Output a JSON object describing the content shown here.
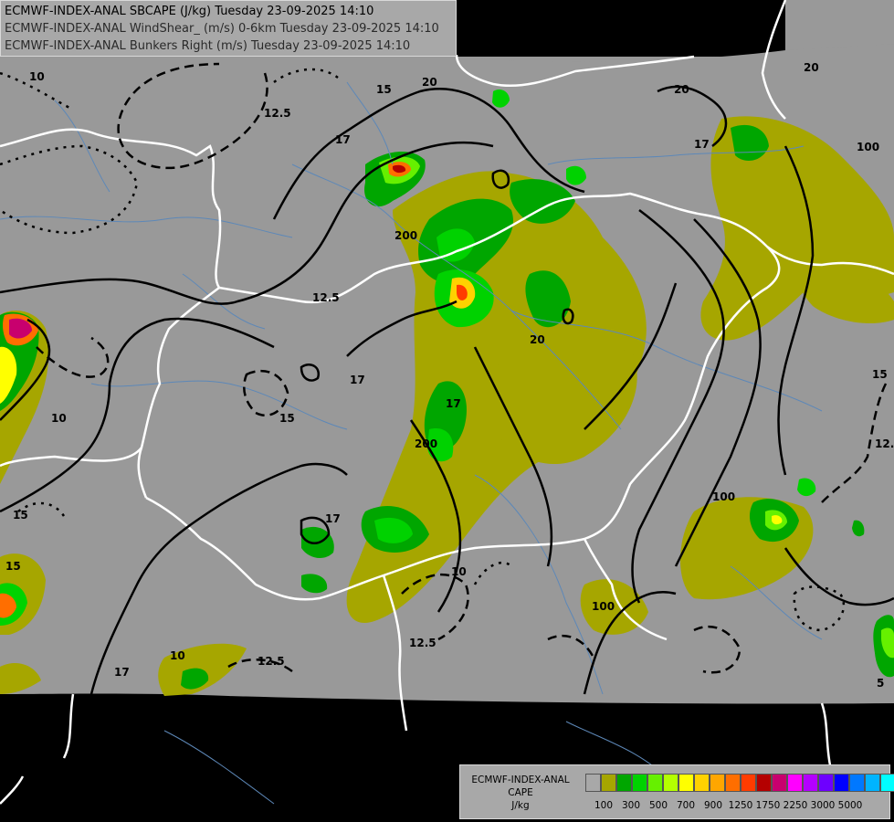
{
  "titles": [
    "ECMWF-INDEX-ANAL SBCAPE (J/kg) Tuesday 23-09-2025 14:10",
    "ECMWF-INDEX-ANAL WindShear_ (m/s) 0-6km Tuesday 23-09-2025 14:10",
    "ECMWF-INDEX-ANAL Bunkers Right (m/s) Tuesday 23-09-2025 14:10"
  ],
  "legend": {
    "title_line1": "ECMWF-INDEX-ANAL",
    "title_line2": "CAPE",
    "unit": "J/kg",
    "swatch_colors": [
      "#a8a8a8",
      "#a6a600",
      "#00a600",
      "#00d200",
      "#66f000",
      "#b4ff00",
      "#ffff00",
      "#ffd200",
      "#ffa600",
      "#ff6e00",
      "#ff3c00",
      "#b40000",
      "#c8006e",
      "#ff00ff",
      "#b400ff",
      "#6e00ff",
      "#0000ff",
      "#0078ff",
      "#00b4ff",
      "#00ffff",
      "#96ffff",
      "#ffffff"
    ],
    "tick_labels": [
      "100",
      "300",
      "500",
      "700",
      "900",
      "1250",
      "1750",
      "2250",
      "3000",
      "5000"
    ]
  },
  "contour_labels": [
    "10",
    "12.5",
    "15",
    "17",
    "20",
    "10",
    "12.5",
    "15",
    "17",
    "20",
    "17",
    "12.5",
    "10",
    "15",
    "17",
    "20",
    "15",
    "12.5",
    "17",
    "100",
    "200",
    "100",
    "200",
    "100",
    "20",
    "17",
    "15",
    "12.5",
    "10",
    "5"
  ],
  "colors": {
    "domain": "#999999",
    "outside": "#000000",
    "border": "#ffffff",
    "river": "#5d88b8",
    "contour": "#000000"
  }
}
